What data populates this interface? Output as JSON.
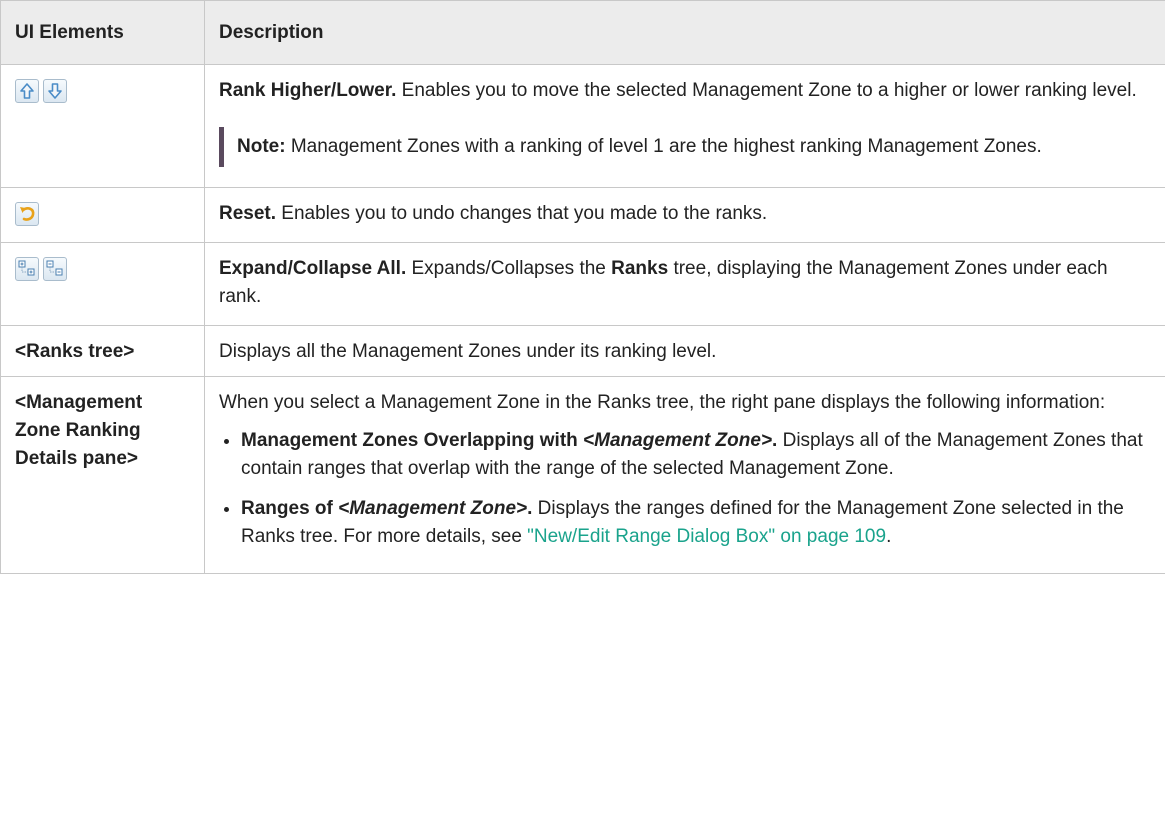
{
  "header": {
    "col1": "UI Elements",
    "col2": "Description"
  },
  "rows": {
    "rank": {
      "icons": [
        "arrow-up-icon",
        "arrow-down-icon"
      ],
      "title": "Rank Higher/Lower.",
      "desc": " Enables you to move the selected Management Zone to a higher or lower ranking level.",
      "note_label": "Note:",
      "note_text": " Management Zones with a ranking of level 1 are the highest ranking Management Zones."
    },
    "reset": {
      "icons": [
        "undo-icon"
      ],
      "title": "Reset.",
      "desc": " Enables you to undo changes that you made to the ranks."
    },
    "expand": {
      "icons": [
        "expand-all-icon",
        "collapse-all-icon"
      ],
      "title": "Expand/Collapse All.",
      "desc_a": " Expands/Collapses the ",
      "desc_bold": "Ranks",
      "desc_b": " tree, displaying the Management Zones under each rank."
    },
    "ranks_tree": {
      "label": "<Ranks tree>",
      "desc": "Displays all the Management Zones under its ranking level."
    },
    "details": {
      "label": "<Management Zone Ranking Details pane>",
      "intro": "When you select a Management Zone in the Ranks tree, the right pane displays the following information:",
      "bullets": [
        {
          "bold_a": "Management Zones Overlapping with ",
          "bold_italic": "<Management Zone>",
          "bold_b": ".",
          "text": " Displays all of the Management Zones that contain ranges that overlap with the range of the selected Management Zone."
        },
        {
          "bold_a": "Ranges of ",
          "bold_italic": "<Management Zone>",
          "bold_b": ".",
          "text": " Displays the ranges defined for the Management Zone selected in the Ranks tree. For more details, see ",
          "link": "\"New/Edit Range Dialog Box\" on page 109",
          "tail": "."
        }
      ]
    }
  }
}
